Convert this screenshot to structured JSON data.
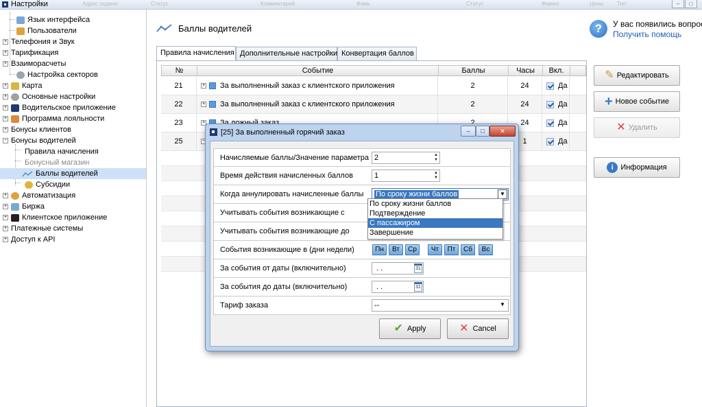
{
  "window": {
    "title": "Настройки",
    "ghost_headers": [
      "Адрес подачи",
      "Статус",
      "Комментарий",
      "Фамь",
      "Статус",
      "Фамил",
      "Цены",
      "Тип"
    ]
  },
  "sidebar": {
    "items": [
      {
        "label": "Язык интерфейса",
        "icon": "language-icon",
        "color": "#7aa7d9"
      },
      {
        "label": "Пользователи",
        "icon": "users-icon",
        "color": "#e0a23c"
      },
      {
        "label": "Телефония и Звук",
        "expander": "+"
      },
      {
        "label": "Тарификация",
        "expander": "+"
      },
      {
        "label": "Взаиморасчеты",
        "expander": "+"
      },
      {
        "label": "Настройка секторов",
        "icon": "sectors-icon",
        "color": "#9aa4b2"
      },
      {
        "label": "Карта",
        "expander": "+",
        "icon": "map-icon",
        "color": "#d9b640"
      },
      {
        "label": "Основные настройки",
        "expander": "+",
        "icon": "gear-icon",
        "color": "#a0a0a0"
      },
      {
        "label": "Водительское приложение",
        "expander": "+",
        "icon": "driver-app-icon",
        "color": "#1e3a6e"
      },
      {
        "label": "Программа лояльности",
        "expander": "+",
        "icon": "loyalty-icon",
        "color": "#e08a3c"
      },
      {
        "label": "Бонусы клиентов",
        "expander": "+"
      },
      {
        "label": "Бонусы водителей",
        "expander": "−"
      },
      {
        "label": "Правила начисления"
      },
      {
        "label": "Бонусный магазин"
      },
      {
        "label": "Баллы водителей",
        "icon": "chart-line-icon",
        "color": "#8fb0d0"
      },
      {
        "label": "Субсидии",
        "icon": "coins-icon",
        "color": "#e0b43c"
      },
      {
        "label": "Автоматизация",
        "expander": "+",
        "icon": "clock-icon",
        "color": "#e0a23c"
      },
      {
        "label": "Биржа",
        "expander": "+",
        "icon": "exchange-icon",
        "color": "#7aa7d9"
      },
      {
        "label": "Клиентское приложение",
        "expander": "+",
        "icon": "client-app-icon",
        "color": "#222"
      },
      {
        "label": "Платежные системы",
        "expander": "+"
      },
      {
        "label": "Доступ к API",
        "expander": "+"
      }
    ]
  },
  "header": {
    "title": "Баллы водителей",
    "help_text": "У вас появились вопросы",
    "help_link": "Получить помощь"
  },
  "tabs": [
    {
      "label": "Правила начисления",
      "active": true
    },
    {
      "label": "Дополнительные настройки",
      "active": false
    },
    {
      "label": "Конвертация баллов",
      "active": false
    }
  ],
  "grid": {
    "columns": [
      "№",
      "Событие",
      "Баллы",
      "Часы",
      "Вкл."
    ],
    "rows": [
      {
        "num": "21",
        "event": "За выполненный заказ с клиентского приложения",
        "points": "2",
        "hours": "24",
        "enabled": "Да"
      },
      {
        "num": "22",
        "event": "За выполненный заказ с клиентского приложения",
        "points": "2",
        "hours": "24",
        "enabled": "Да"
      },
      {
        "num": "23",
        "event": "За ложный заказ",
        "points": "2",
        "hours": "24",
        "enabled": "Да"
      },
      {
        "num": "25",
        "event": "",
        "points": "",
        "hours": "1",
        "enabled": "Да"
      }
    ]
  },
  "actions": {
    "edit": "Редактировать",
    "new_event": "Новое событие",
    "delete": "Удалить",
    "info": "Информация"
  },
  "dialog": {
    "title": "[25] За выполненный горячий заказ",
    "fields": {
      "points_label": "Начисляемые баллы/Значение параметра",
      "points_value": "2",
      "duration_label": "Время действия начисленных баллов",
      "duration_value": "1",
      "cancel_when_label": "Когда аннулировать начисленные баллы",
      "cancel_when_value": "По сроку жизни баллов",
      "count_from_label": "Учитывать события возникающие с",
      "count_to_label": "Учитывать события возникающие до",
      "weekdays_label": "События возникающие в (дни недели)",
      "weekdays": [
        "Пн",
        "Вт",
        "Ср",
        "Чт",
        "Пт",
        "Сб",
        "Вс"
      ],
      "date_from_label": "За события от даты (включительно)",
      "date_from_value": ". .",
      "date_to_label": "За события до даты (включительно)",
      "date_to_value": ". .",
      "calendar_day": "31",
      "tariff_label": "Тариф заказа",
      "tariff_value": "--"
    },
    "dropdown_options": [
      "По сроку жизни баллов",
      "Подтверждение",
      "С пассажиром",
      "Завершение"
    ],
    "dropdown_highlighted": "С пассажиром",
    "apply": "Apply",
    "cancel": "Cancel"
  }
}
